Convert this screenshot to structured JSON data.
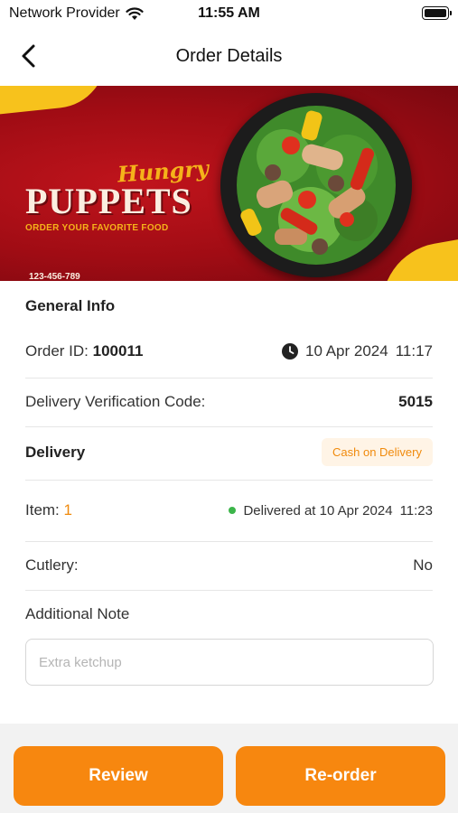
{
  "status_bar": {
    "carrier": "Network Provider",
    "time": "11:55 AM",
    "wifi_icon": "wifi-icon",
    "battery_icon": "battery-icon",
    "battery_level": 1.0
  },
  "header": {
    "title": "Order Details",
    "back_icon": "chevron-left-icon"
  },
  "banner": {
    "script": "Hungry",
    "brand": "PUPPETS",
    "tagline": "ORDER YOUR FAVORITE FOOD",
    "phone": "123-456-789"
  },
  "general_info": {
    "title": "General Info",
    "order_id_label": "Order ID:",
    "order_id": "100011",
    "order_date": "10 Apr 2024",
    "order_time": "11:17",
    "verification_label": "Delivery Verification Code:",
    "verification_code": "5015"
  },
  "delivery": {
    "title": "Delivery",
    "payment_badge": "Cash on Delivery",
    "item_label": "Item:",
    "item_count": "1",
    "status_text": "Delivered at 10 Apr 2024",
    "status_time": "11:23",
    "status_color": "#3cb54a",
    "cutlery_label": "Cutlery:",
    "cutlery_value": "No"
  },
  "note": {
    "label": "Additional Note",
    "placeholder": "Extra ketchup"
  },
  "actions": {
    "review_label": "Review",
    "reorder_label": "Re-order"
  },
  "colors": {
    "accent": "#f7870f",
    "banner_red": "#a00c14",
    "banner_yellow": "#f7c21c"
  }
}
